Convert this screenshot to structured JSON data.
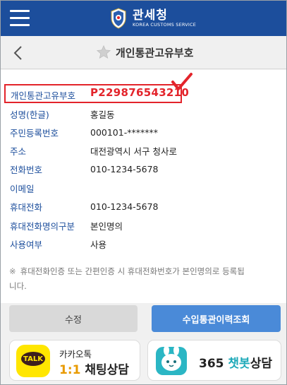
{
  "header": {
    "brand_ko": "관세청",
    "brand_en": "KOREA CUSTOMS SERVICE",
    "menu_icon": "hamburger-icon",
    "colors": {
      "header_bg": "#1c4e9c"
    }
  },
  "titlebar": {
    "title": "개인통관고유부호",
    "back_icon": "chevron-left-icon",
    "star_icon": "star-icon"
  },
  "info": {
    "code_label": "개인통관고유부호",
    "code_value": "P229876543210",
    "rows": [
      {
        "label": "성명(한글)",
        "value": "홍길동"
      },
      {
        "label": "주민등록번호",
        "value": "000101-*******"
      },
      {
        "label": "주소",
        "value": "대전광역시 서구 청사로"
      },
      {
        "label": "전화번호",
        "value": "010-1234-5678"
      },
      {
        "label": "이메일",
        "value": ""
      },
      {
        "label": "휴대전화",
        "value": "010-1234-5678"
      },
      {
        "label": "휴대전화명의구분",
        "value": "본인명의"
      },
      {
        "label": "사용여부",
        "value": "사용"
      }
    ]
  },
  "note": {
    "mark": "※",
    "line1": "휴대전화인증 또는 간편인증 시 휴대전화번호가 본인명의로 등록됩",
    "line2": "니다."
  },
  "buttons": {
    "edit": "수정",
    "history": "수입통관이력조회"
  },
  "cards": {
    "kakao_logo_text": "TALK",
    "kakao_line1": "카카오톡",
    "kakao_line2_accent": "1:1",
    "kakao_line2_rest": " 채팅상담",
    "chatbot_prefix": "365 ",
    "chatbot_accent": "챗봇",
    "chatbot_suffix": "상담"
  }
}
